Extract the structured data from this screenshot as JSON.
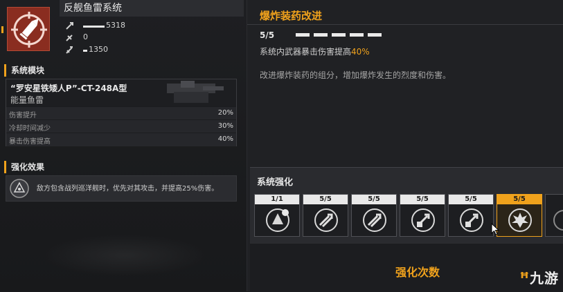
{
  "weapon": {
    "title": "反舰鱼雷系统",
    "stats": [
      {
        "value": "5318",
        "level": 0.26,
        "icon": "damage-icon"
      },
      {
        "value": "0",
        "level": 0.0,
        "icon": "rate-icon"
      },
      {
        "value": "1350",
        "level": 0.05,
        "icon": "range-icon"
      }
    ]
  },
  "system_module": {
    "heading": "系统模块",
    "name": "“罗安星铁矮人P”-CT-248A型",
    "type": "能量鱼雷",
    "rows": [
      {
        "label": "伤害提升",
        "value": "20%"
      },
      {
        "label": "冷却时间减少",
        "value": "30%"
      },
      {
        "label": "暴击伤害提高",
        "value": "40%"
      }
    ]
  },
  "enhance_effect": {
    "heading": "强化效果",
    "text": "敌方包含战列巡洋舰时，优先对其攻击，并提高25%伤害。"
  },
  "upgrade": {
    "title": "爆炸装药改进",
    "level": "5/5",
    "level_value": 5,
    "level_max": 5,
    "bonus_prefix": "系统内武器暴击伤害提高",
    "bonus_value": "40%",
    "description": "改进爆炸装药的组分，增加爆炸发生的烈度和伤害。"
  },
  "system_enhance": {
    "heading": "系统强化",
    "slots": [
      {
        "count": "1/1",
        "icon": "core-module-icon"
      },
      {
        "count": "5/5",
        "icon": "missile-icon"
      },
      {
        "count": "5/5",
        "icon": "missile-icon"
      },
      {
        "count": "5/5",
        "icon": "damage-up-icon"
      },
      {
        "count": "5/5",
        "icon": "damage-up-icon"
      },
      {
        "count": "5/5",
        "icon": "explosion-icon",
        "selected": true
      }
    ],
    "count_label": "强化次数"
  },
  "watermark": {
    "text": "九游"
  },
  "colors": {
    "accent": "#f0a21c",
    "weapon_icon_bg": "#8a2d20"
  }
}
